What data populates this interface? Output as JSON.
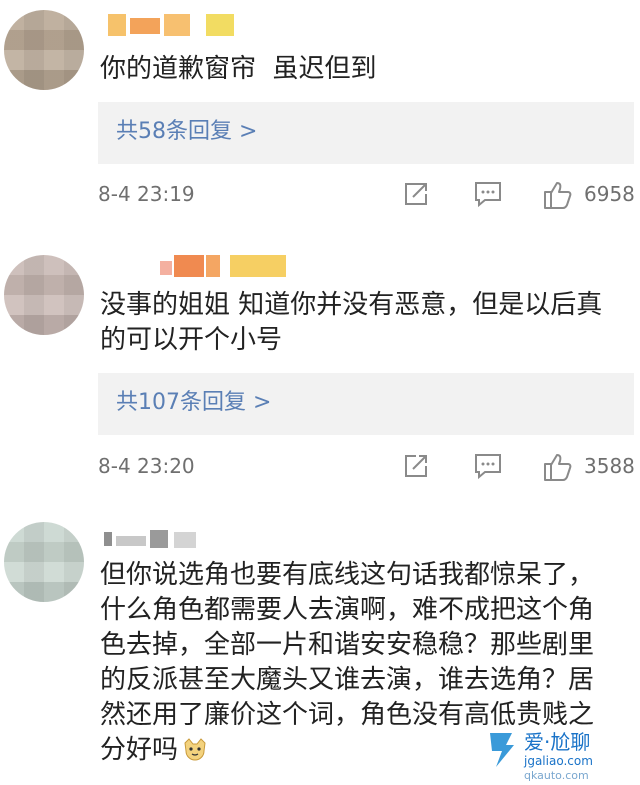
{
  "comments": [
    {
      "text": "你的道歉窗帘  虽迟但到",
      "replies": "共58条回复 >",
      "time": "8-4 23:19",
      "likes": "6958"
    },
    {
      "text": "没事的姐姐 知道你并没有恶意，但是以后真\n的可以开个小号",
      "replies": "共107条回复 >",
      "time": "8-4 23:20",
      "likes": "3588"
    },
    {
      "text": "但你说选角也要有底线这句话我都惊呆了，\n什么角色都需要人去演啊，难不成把这个角\n色去掉，全部一片和谐安安稳稳？那些剧里\n的反派甚至大魔头又谁去演，谁去选角？居\n然还用了廉价这个词，角色没有高低贵贱之\n分好吗"
    }
  ],
  "icons": [
    "share-icon",
    "comment-icon",
    "like-icon",
    "doge-emoji-icon"
  ],
  "colors": {
    "link": "#5a7fb5",
    "reply_bg": "#f2f2f2",
    "meta": "#6f6f6f"
  },
  "watermark": {
    "line1": "爱·尬聊",
    "line2": "jgaliao.com",
    "line3": "qkauto.com"
  }
}
